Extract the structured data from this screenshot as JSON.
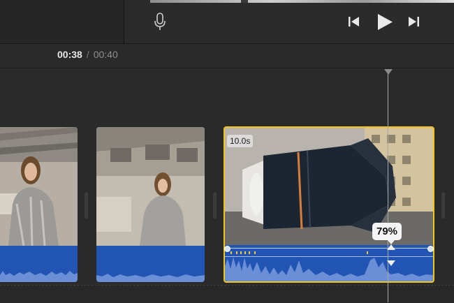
{
  "viewer": {
    "icons": {
      "voiceover": "microphone-icon",
      "skip_back": "skip-to-start-icon",
      "play": "play-icon",
      "skip_forward": "skip-to-end-icon"
    }
  },
  "timecode": {
    "current": "00:38",
    "separator": "/",
    "total": "00:40"
  },
  "timeline": {
    "selected_clip": {
      "duration_label": "10.0s",
      "volume_label": "79%",
      "volume_level_percent": 79
    },
    "colors": {
      "selection_border": "#f5c518",
      "audio_waveform_bg": "#2154b3",
      "audio_waveform_fg": "#6a8fd6",
      "playhead": "#a9a9a9"
    }
  }
}
